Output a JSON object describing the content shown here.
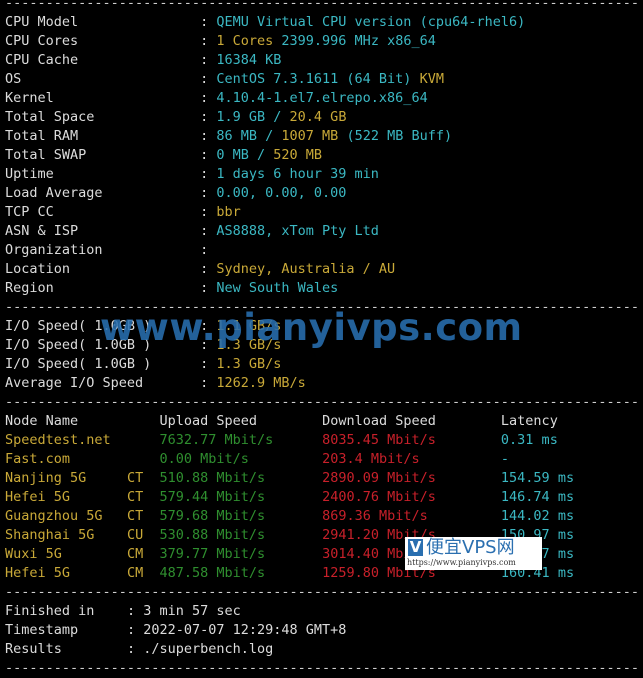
{
  "colors": {
    "label": "#dcdcdc",
    "cyan": "#3bb8c3",
    "yellow": "#c9a938",
    "green": "#2f8f2f",
    "red": "#c8202a"
  },
  "separator": "-----------------------------------------------------------------------------------",
  "system_info": [
    {
      "label": "CPU Model",
      "value": [
        {
          "t": "QEMU Virtual CPU version (cpu64-rhel6)",
          "c": "cyan"
        }
      ]
    },
    {
      "label": "CPU Cores",
      "value": [
        {
          "t": "1 Cores",
          "c": "yellow"
        },
        {
          "t": " 2399.996 MHz x86_64",
          "c": "cyan"
        }
      ]
    },
    {
      "label": "CPU Cache",
      "value": [
        {
          "t": "16384 KB",
          "c": "cyan"
        }
      ]
    },
    {
      "label": "OS",
      "value": [
        {
          "t": "CentOS 7.3.1611 (64 Bit) ",
          "c": "cyan"
        },
        {
          "t": "KVM",
          "c": "yellow"
        }
      ]
    },
    {
      "label": "Kernel",
      "value": [
        {
          "t": "4.10.4-1.el7.elrepo.x86_64",
          "c": "cyan"
        }
      ]
    },
    {
      "label": "Total Space",
      "value": [
        {
          "t": "1.9 GB / ",
          "c": "cyan"
        },
        {
          "t": "20.4 GB",
          "c": "yellow"
        }
      ]
    },
    {
      "label": "Total RAM",
      "value": [
        {
          "t": "86 MB / ",
          "c": "cyan"
        },
        {
          "t": "1007 MB",
          "c": "yellow"
        },
        {
          "t": " (522 MB Buff)",
          "c": "cyan"
        }
      ]
    },
    {
      "label": "Total SWAP",
      "value": [
        {
          "t": "0 MB / ",
          "c": "cyan"
        },
        {
          "t": "520 MB",
          "c": "yellow"
        }
      ]
    },
    {
      "label": "Uptime",
      "value": [
        {
          "t": "1 days 6 hour 39 min",
          "c": "cyan"
        }
      ]
    },
    {
      "label": "Load Average",
      "value": [
        {
          "t": "0.00, 0.00, 0.00",
          "c": "cyan"
        }
      ]
    },
    {
      "label": "TCP CC",
      "value": [
        {
          "t": "bbr",
          "c": "yellow"
        }
      ]
    },
    {
      "label": "ASN & ISP",
      "value": [
        {
          "t": "AS8888, xTom Pty Ltd",
          "c": "cyan"
        }
      ]
    },
    {
      "label": "Organization",
      "value": []
    },
    {
      "label": "Location",
      "value": [
        {
          "t": "Sydney, Australia / AU",
          "c": "yellow"
        }
      ]
    },
    {
      "label": "Region",
      "value": [
        {
          "t": "New South Wales",
          "c": "cyan"
        }
      ]
    }
  ],
  "io": [
    {
      "label": "I/O Speed( 1.0GB )",
      "value": "1.1 GB/s"
    },
    {
      "label": "I/O Speed( 1.0GB )",
      "value": "1.3 GB/s"
    },
    {
      "label": "I/O Speed( 1.0GB )",
      "value": "1.3 GB/s"
    },
    {
      "label": "Average I/O Speed",
      "value": "1262.9 MB/s"
    }
  ],
  "speed_headers": [
    "Node Name",
    "Upload Speed",
    "Download Speed",
    "Latency"
  ],
  "speed_rows": [
    {
      "node": "Speedtest.net",
      "isp": "",
      "up": "7632.77 Mbit/s",
      "down": "8035.45 Mbit/s",
      "lat": "0.31 ms"
    },
    {
      "node": "Fast.com",
      "isp": "",
      "up": "0.00 Mbit/s",
      "down": "203.4 Mbit/s",
      "lat": "-"
    },
    {
      "node": "Nanjing 5G",
      "isp": "CT",
      "up": "510.88 Mbit/s",
      "down": "2890.09 Mbit/s",
      "lat": "154.59 ms"
    },
    {
      "node": "Hefei 5G",
      "isp": "CT",
      "up": "579.44 Mbit/s",
      "down": "2400.76 Mbit/s",
      "lat": "146.74 ms"
    },
    {
      "node": "Guangzhou 5G",
      "isp": "CT",
      "up": "579.68 Mbit/s",
      "down": "869.36 Mbit/s",
      "lat": "144.02 ms"
    },
    {
      "node": "Shanghai 5G",
      "isp": "CU",
      "up": "530.88 Mbit/s",
      "down": "2941.20 Mbit/s",
      "lat": "150.97 ms"
    },
    {
      "node": "Wuxi 5G",
      "isp": "CM",
      "up": "379.77 Mbit/s",
      "down": "3014.40 Mbit/s",
      "lat": "     7 ms"
    },
    {
      "node": "Hefei 5G",
      "isp": "CM",
      "up": "487.58 Mbit/s",
      "down": "1259.80 Mbit/s",
      "lat": "160.41 ms"
    }
  ],
  "summary": [
    {
      "label": "Finished in",
      "value": "3 min 57 sec"
    },
    {
      "label": "Timestamp",
      "value": "2022-07-07 12:29:48 GMT+8"
    },
    {
      "label": "Results",
      "value": "./superbench.log"
    }
  ],
  "watermarks": {
    "main": "www.pianyivps.com",
    "badge_logo": "V",
    "badge_title": "便宜VPS网",
    "badge_url": "https://www.pianyivps.com"
  }
}
